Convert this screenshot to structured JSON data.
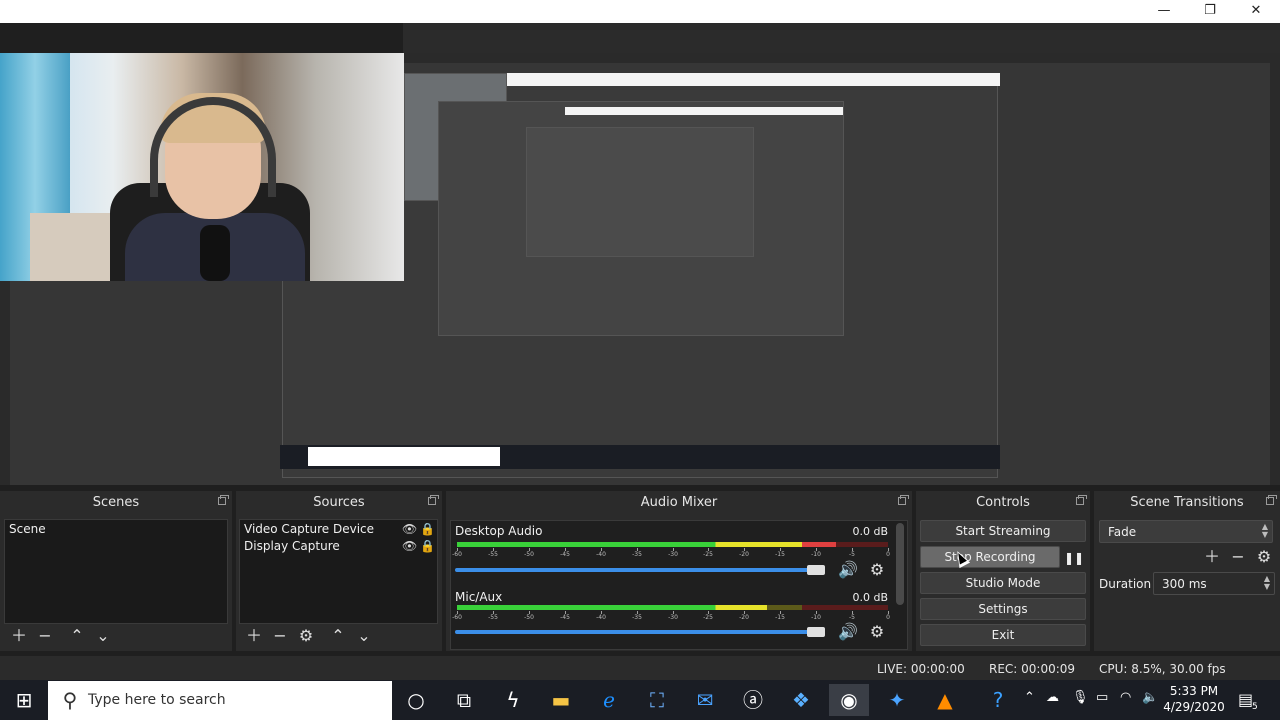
{
  "window": {
    "minimize_glyph": "—",
    "maximize_glyph": "❐",
    "close_glyph": "✕"
  },
  "docks": {
    "scenes": {
      "title": "Scenes",
      "items": [
        "Scene"
      ]
    },
    "sources": {
      "title": "Sources",
      "items": [
        "Video Capture Device",
        "Display Capture"
      ]
    },
    "audio_mixer": {
      "title": "Audio Mixer",
      "channels": [
        {
          "name": "Desktop Audio",
          "db": "0.0 dB",
          "level": 0.88,
          "volume": 1.0
        },
        {
          "name": "Mic/Aux",
          "db": "0.0 dB",
          "level": 0.72,
          "volume": 1.0
        }
      ],
      "ticks": [
        "-60",
        "-55",
        "-50",
        "-45",
        "-40",
        "-35",
        "-30",
        "-25",
        "-20",
        "-15",
        "-10",
        "-5",
        "0"
      ]
    },
    "controls": {
      "title": "Controls",
      "start_streaming": "Start Streaming",
      "stop_recording": "Stop Recording",
      "studio_mode": "Studio Mode",
      "settings": "Settings",
      "exit": "Exit"
    },
    "scene_transitions": {
      "title": "Scene Transitions",
      "transition": "Fade",
      "duration_label": "Duration",
      "duration_value": "300 ms"
    }
  },
  "status": {
    "live": "LIVE: 00:00:00",
    "rec": "REC: 00:00:09",
    "cpu": "CPU: 8.5%, 30.00 fps"
  },
  "taskbar": {
    "search_placeholder": "Type here to search",
    "time": "5:33 PM",
    "date": "4/29/2020",
    "notification_count": "5"
  },
  "colors": {
    "dock_bg": "#2b2b2b",
    "list_bg": "#1a1a1a",
    "slider": "#3b8ee8",
    "taskbar": "#1a1d24"
  }
}
